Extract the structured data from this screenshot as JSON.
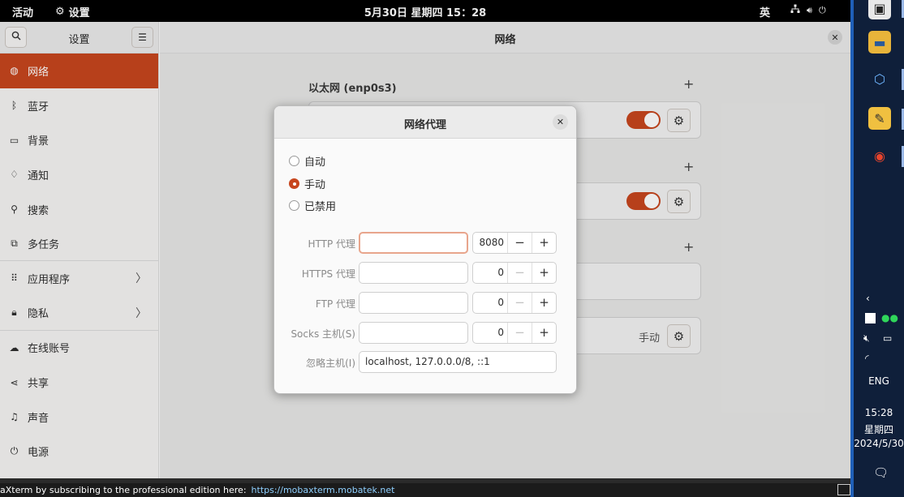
{
  "topbar": {
    "activities": "活动",
    "app_name": "设置",
    "clock": "5月30日 星期四  15：28",
    "ime": "英"
  },
  "sidebar": {
    "title": "设置",
    "items": [
      {
        "label": "网络",
        "icon": "network-icon",
        "glyph": "◍"
      },
      {
        "label": "蓝牙",
        "icon": "bluetooth-icon",
        "glyph": "ᛒ"
      },
      {
        "label": "背景",
        "icon": "display-icon",
        "glyph": "▭"
      },
      {
        "label": "通知",
        "icon": "bell-icon",
        "glyph": "♢"
      },
      {
        "label": "搜索",
        "icon": "search-icon",
        "glyph": "⚲"
      },
      {
        "label": "多任务",
        "icon": "multitask-icon",
        "glyph": "⧉"
      },
      {
        "label": "应用程序",
        "icon": "apps-grid-icon",
        "glyph": "⠿"
      },
      {
        "label": "隐私",
        "icon": "lock-icon",
        "glyph": "🔒︎"
      },
      {
        "label": "在线账号",
        "icon": "cloud-icon",
        "glyph": "☁"
      },
      {
        "label": "共享",
        "icon": "share-icon",
        "glyph": "⋖"
      },
      {
        "label": "声音",
        "icon": "music-icon",
        "glyph": "♫"
      },
      {
        "label": "电源",
        "icon": "power-icon",
        "glyph": "⏻"
      }
    ]
  },
  "content": {
    "title": "网络",
    "ethernet_title": "以太网 (enp0s3)",
    "proxy_value": "手动"
  },
  "dialog": {
    "title": "网络代理",
    "modes": [
      "自动",
      "手动",
      "已禁用"
    ],
    "selected_mode": "手动",
    "rows": [
      {
        "label": "HTTP 代理",
        "host": "",
        "port": "8080"
      },
      {
        "label": "HTTPS 代理",
        "host": "",
        "port": "0"
      },
      {
        "label": "FTP 代理",
        "host": "",
        "port": "0"
      },
      {
        "label": "Socks 主机(S)",
        "host": "",
        "port": "0"
      }
    ],
    "ignore_label": "忽略主机(I)",
    "ignore_hosts": "localhost, 127.0.0.0/8, ::1"
  },
  "bottombar": {
    "text": "aXterm by subscribing to the professional edition here:",
    "link": "https://mobaxterm.mobatek.net"
  },
  "taskbar": {
    "lang": "ENG",
    "time": "15:28",
    "weekday": "星期四",
    "date": "2024/5/30"
  },
  "colors": {
    "accent": "#c7461e",
    "taskbar": "#0f1f3a"
  }
}
